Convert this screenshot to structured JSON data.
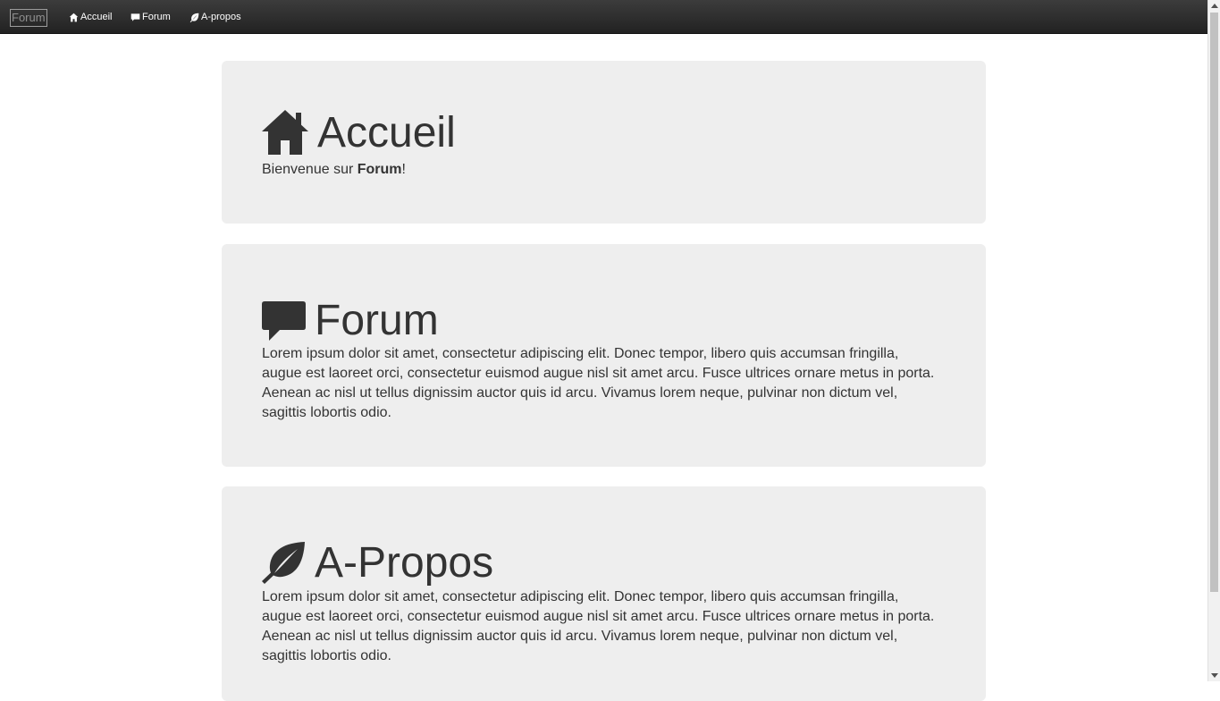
{
  "navbar": {
    "brand": "Forum",
    "links": [
      {
        "label": "Accueil",
        "icon": "home-icon"
      },
      {
        "label": "Forum",
        "icon": "comment-icon"
      },
      {
        "label": "A-propos",
        "icon": "leaf-icon"
      }
    ]
  },
  "sections": {
    "accueil": {
      "title": "Accueil",
      "icon": "home-icon",
      "welcome_prefix": "Bienvenue sur ",
      "welcome_brand": "Forum",
      "welcome_suffix": "!"
    },
    "forum": {
      "title": "Forum",
      "icon": "comment-icon",
      "text": "Lorem ipsum dolor sit amet, consectetur adipiscing elit. Donec tempor, libero quis accumsan fringilla, augue est laoreet orci, consectetur euismod augue nisl sit amet arcu. Fusce ultrices ornare metus in porta. Aenean ac nisl ut tellus dignissim auctor quis id arcu. Vivamus lorem neque, pulvinar non dictum vel, sagittis lobortis odio."
    },
    "apropos": {
      "title": "A-Propos",
      "icon": "leaf-icon",
      "text": "Lorem ipsum dolor sit amet, consectetur adipiscing elit. Donec tempor, libero quis accumsan fringilla, augue est laoreet orci, consectetur euismod augue nisl sit amet arcu. Fusce ultrices ornare metus in porta. Aenean ac nisl ut tellus dignissim auctor quis id arcu. Vivamus lorem neque, pulvinar non dictum vel, sagittis lobortis odio."
    }
  },
  "colors": {
    "navbar_bg": "#222222",
    "panel_bg": "#eeeeee",
    "text": "#333333"
  }
}
